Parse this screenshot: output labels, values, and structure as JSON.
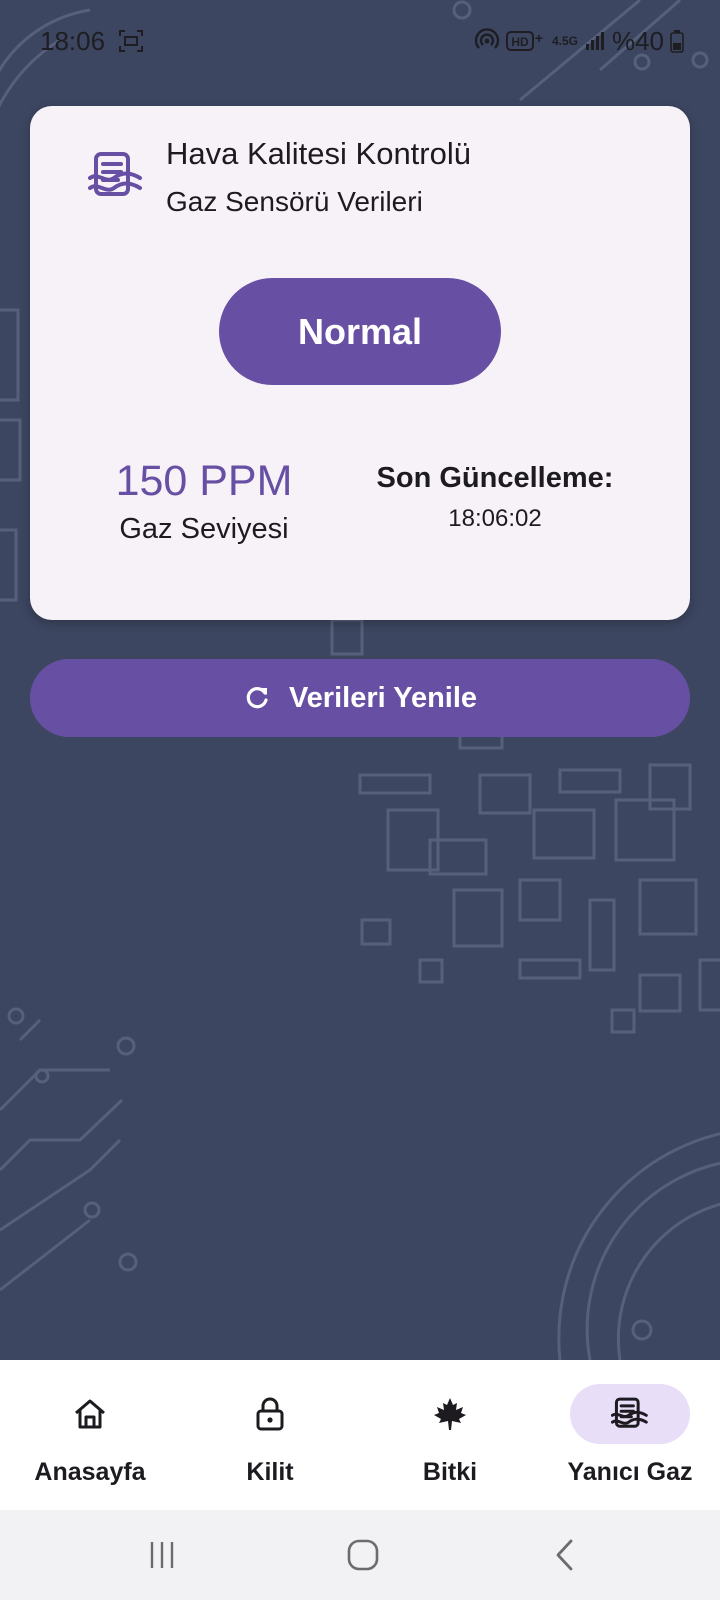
{
  "status_bar": {
    "time": "18:06",
    "network_label": "4.5G",
    "battery_text": "%40"
  },
  "card": {
    "icon": "gas-sensor-icon",
    "title": "Hava Kalitesi Kontrolü",
    "subtitle": "Gaz Sensörü Verileri",
    "status": "Normal",
    "gas_value": "150 PPM",
    "gas_label": "Gaz Seviyesi",
    "update_label": "Son Güncelleme:",
    "update_time": "18:06:02"
  },
  "refresh_button": {
    "icon": "refresh-icon",
    "label": "Verileri Yenile"
  },
  "bottom_nav": {
    "items": [
      {
        "label": "Anasayfa",
        "icon": "home-icon",
        "active": false
      },
      {
        "label": "Kilit",
        "icon": "lock-icon",
        "active": false
      },
      {
        "label": "Bitki",
        "icon": "leaf-icon",
        "active": false
      },
      {
        "label": "Yanıcı Gaz",
        "icon": "gas-sensor-icon",
        "active": true
      }
    ]
  },
  "system_nav": {
    "buttons": [
      "recents-icon",
      "home-circle-icon",
      "back-icon"
    ]
  },
  "colors": {
    "background": "#3c4660",
    "accent": "#6750a4",
    "card": "#f7f2f8",
    "active_indicator": "#e8def8"
  }
}
